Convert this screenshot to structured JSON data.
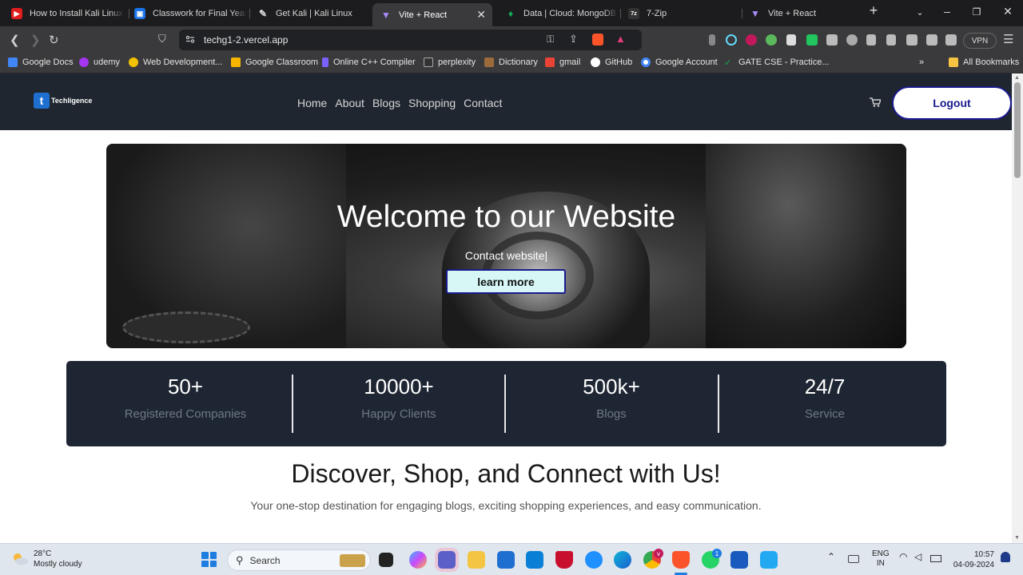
{
  "browser": {
    "tabs": [
      {
        "title": "How to Install Kali Linux in",
        "color": "#e11d1d",
        "glyph": "▶"
      },
      {
        "title": "Classwork for Final Year C",
        "color": "#1a73e8",
        "glyph": "▣"
      },
      {
        "title": "Get Kali | Kali Linux",
        "color": "#555555",
        "glyph": "✎"
      },
      {
        "title": "Vite + React",
        "color": "#8b5cf6",
        "glyph": "▼",
        "active": true
      },
      {
        "title": "Data | Cloud: MongoDB C",
        "color": "#13aa52",
        "glyph": "♦"
      },
      {
        "title": "7-Zip",
        "color": "#444444",
        "glyph": "7z"
      },
      {
        "title": "Vite + React",
        "color": "#8b5cf6",
        "glyph": "▼"
      }
    ],
    "url": "techg1-2.vercel.app",
    "vpn_label": "VPN",
    "bookmarks": [
      {
        "label": "Google Docs",
        "color": "#4285f4"
      },
      {
        "label": "udemy",
        "color": "#a435f0"
      },
      {
        "label": "Web Development...",
        "color": "#f2c200"
      },
      {
        "label": "Google Classroom",
        "color": "#f7b500"
      },
      {
        "label": "Online C++ Compiler",
        "color": "#7b61ff"
      },
      {
        "label": "perplexity",
        "color": "#222222"
      },
      {
        "label": "Dictionary",
        "color": "#9c6b3c"
      },
      {
        "label": "gmail",
        "color": "#ea4335"
      },
      {
        "label": "GitHub",
        "color": "#ffffff"
      },
      {
        "label": "Google Account",
        "color": "#4285f4"
      },
      {
        "label": "GATE CSE - Practice...",
        "color": "#13aa52"
      }
    ],
    "all_bookmarks": "All Bookmarks"
  },
  "site": {
    "logo_text": "Techligence",
    "nav": [
      "Home",
      "About",
      "Blogs",
      "Shopping",
      "Contact"
    ],
    "logout_label": "Logout",
    "hero": {
      "title": "Welcome to our Website",
      "subtitle": "Contact website|",
      "cta": "learn more"
    },
    "stats": [
      {
        "value": "50+",
        "label": "Registered Companies"
      },
      {
        "value": "10000+",
        "label": "Happy Clients"
      },
      {
        "value": "500k+",
        "label": "Blogs"
      },
      {
        "value": "24/7",
        "label": "Service"
      }
    ],
    "discover_title": "Discover, Shop, and Connect with Us!",
    "discover_sub": "Your one-stop destination for engaging blogs, exciting shopping experiences, and easy communication."
  },
  "taskbar": {
    "weather_temp": "28°C",
    "weather_desc": "Mostly cloudy",
    "search_placeholder": "Search",
    "lang_1": "ENG",
    "lang_2": "IN",
    "time": "10:57",
    "date": "04-09-2024",
    "whatsapp_badge": "1"
  }
}
